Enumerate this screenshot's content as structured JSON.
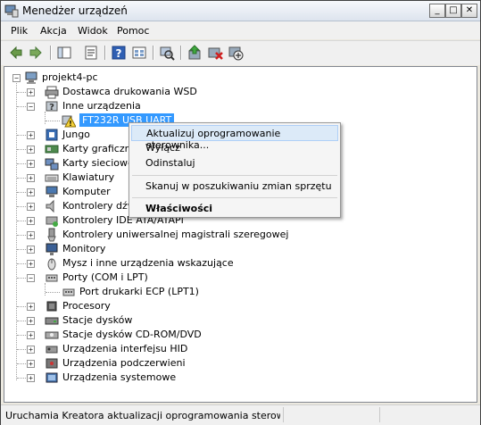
{
  "window": {
    "title": "Menedżer urządzeń",
    "minimize": "_",
    "maximize": "□",
    "close": "✕"
  },
  "menu": [
    {
      "label": "Plik"
    },
    {
      "label": "Akcja"
    },
    {
      "label": "Widok"
    },
    {
      "label": "Pomoc"
    }
  ],
  "toolbar": {
    "icons": [
      "back-icon",
      "forward-icon",
      "show-hide-tree-icon",
      "properties-icon",
      "help-icon",
      "console-icon",
      "scan-hardware-icon",
      "update-driver-icon",
      "uninstall-icon",
      "disable-icon"
    ]
  },
  "tree": {
    "root": "projekt4-pc",
    "items": [
      {
        "label": "Dostawca drukowania WSD",
        "icon": "printer-icon"
      },
      {
        "label": "Inne urządzenia",
        "icon": "unknown-device-icon",
        "expanded": true
      },
      {
        "label": "FT232R USB UART",
        "icon": "warning-device-icon",
        "selected": true
      },
      {
        "label": "Jungo",
        "icon": "device-icon"
      },
      {
        "label": "Karty graficzne",
        "icon": "display-adapter-icon"
      },
      {
        "label": "Karty sieciowe",
        "icon": "network-adapter-icon"
      },
      {
        "label": "Klawiatury",
        "icon": "keyboard-icon"
      },
      {
        "label": "Komputer",
        "icon": "computer-icon"
      },
      {
        "label": "Kontrolery dźwi",
        "icon": "sound-icon"
      },
      {
        "label": "Kontrolery IDE ATA/ATAPI",
        "icon": "ide-controller-icon"
      },
      {
        "label": "Kontrolery uniwersalnej magistrali szeregowej",
        "icon": "usb-icon"
      },
      {
        "label": "Monitory",
        "icon": "monitor-icon"
      },
      {
        "label": "Mysz i inne urządzenia wskazujące",
        "icon": "mouse-icon"
      },
      {
        "label": "Porty (COM i LPT)",
        "icon": "port-icon",
        "expanded": true
      },
      {
        "label": "Port drukarki ECP (LPT1)",
        "icon": "port-icon"
      },
      {
        "label": "Procesory",
        "icon": "processor-icon"
      },
      {
        "label": "Stacje dysków",
        "icon": "disk-drive-icon"
      },
      {
        "label": "Stacje dysków CD-ROM/DVD",
        "icon": "cdrom-icon"
      },
      {
        "label": "Urządzenia interfejsu HID",
        "icon": "hid-icon"
      },
      {
        "label": "Urządzenia podczerwieni",
        "icon": "infrared-icon"
      },
      {
        "label": "Urządzenia systemowe",
        "icon": "system-device-icon"
      }
    ]
  },
  "context_menu": {
    "items": [
      {
        "label": "Aktualizuj oprogramowanie sterownika..."
      },
      {
        "label": "Wyłącz"
      },
      {
        "label": "Odinstaluj"
      },
      {
        "label": "Skanuj w poszukiwaniu zmian sprzętu"
      },
      {
        "label": "Właściwości"
      }
    ]
  },
  "status": {
    "text": "Uruchamia Kreatora aktualizacji oprogramowania sterowników dla"
  },
  "colors": {
    "selection": "#3399ff",
    "menu_highlight": "#dceaf8"
  }
}
